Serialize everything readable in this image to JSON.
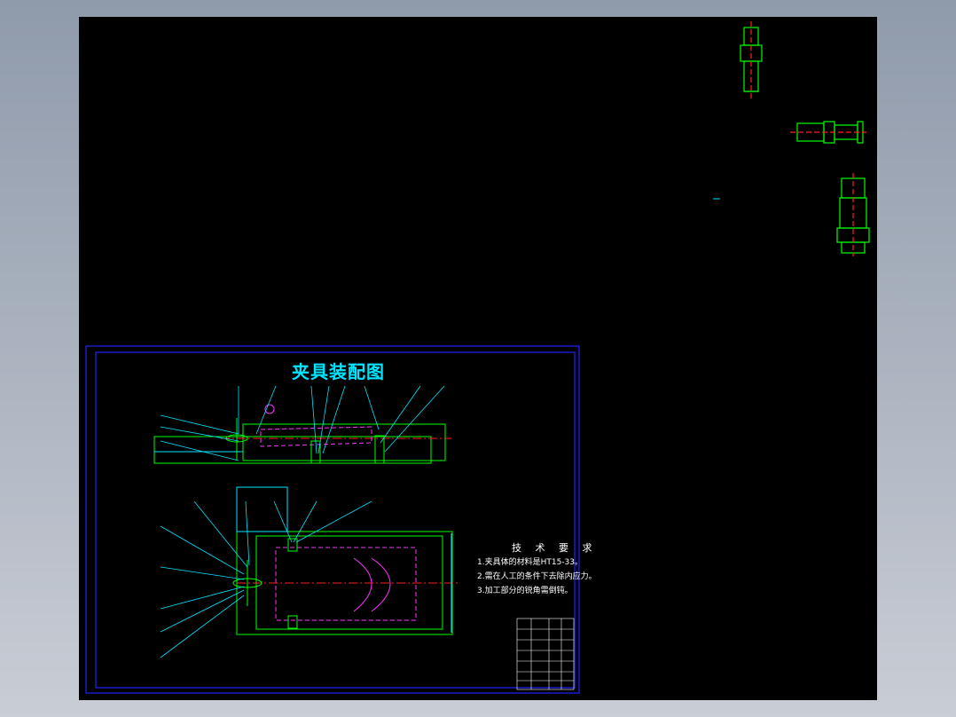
{
  "drawing": {
    "title": "夹具装配图",
    "notes_heading": "技 术 要 求",
    "notes": [
      "1.夹具体的材料是HT15-33。",
      "2.需在人工的条件下去除内应力。",
      "3.加工部分的锐角需倒钝。"
    ]
  },
  "colors": {
    "background": "#000000",
    "frame": "#2222ff",
    "outline": "#00ff00",
    "dimension": "#00e5ff",
    "parts": "#ff33ff",
    "centerline": "#ff2020",
    "text": "#ffffff"
  }
}
